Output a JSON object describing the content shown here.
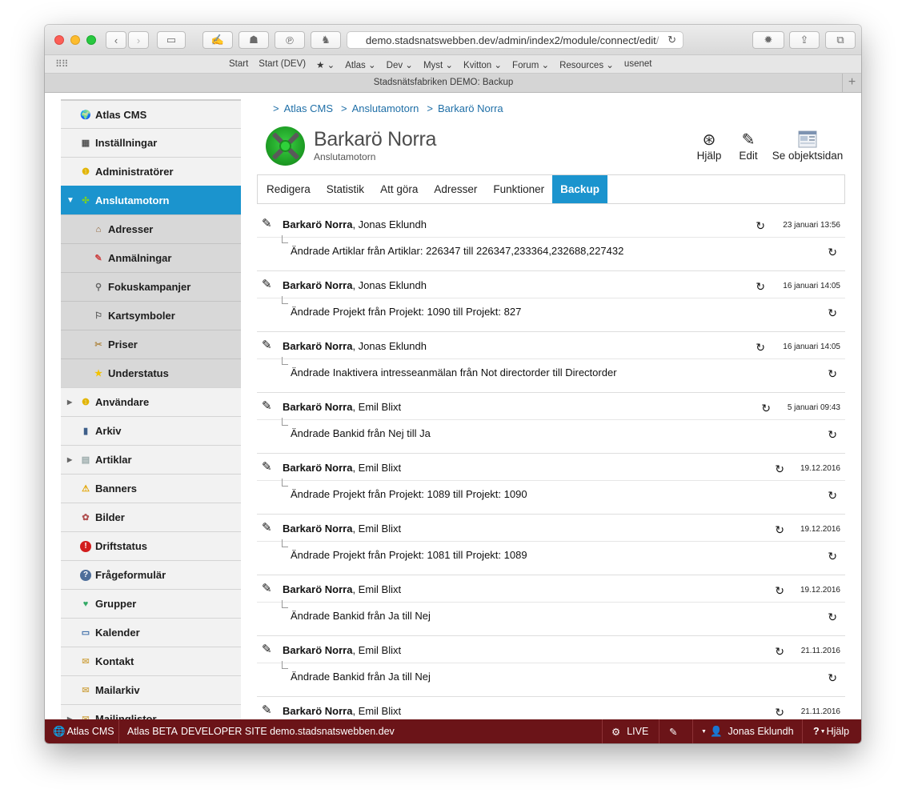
{
  "browser": {
    "url_main": "demo.stadsnatswebben.dev/admin/index2/module/connect/edit",
    "url_dim": "/",
    "tab_title": "Stadsnätsfabriken DEMO: Backup",
    "bookmarks": [
      "Start",
      "Start (DEV)",
      "★ ⌄",
      "Atlas ⌄",
      "Dev ⌄",
      "Myst ⌄",
      "Kvitton ⌄",
      "Forum ⌄",
      "Resources ⌄",
      "usenet"
    ]
  },
  "sidebar": {
    "items": [
      {
        "label": "Atlas CMS",
        "icon": "globe-icon",
        "glyph": "🌍",
        "type": "top"
      },
      {
        "label": "Inställningar",
        "icon": "settings-panel-icon",
        "glyph": "▦",
        "type": "top"
      },
      {
        "label": "Administratörer",
        "icon": "admin-user-icon",
        "glyph": "❶",
        "type": "top"
      },
      {
        "label": "Anslutamotorn",
        "icon": "connect-engine-icon",
        "glyph": "✣",
        "type": "active",
        "arrow": "▼"
      },
      {
        "label": "Adresser",
        "icon": "house-icon",
        "glyph": "⌂",
        "type": "sub"
      },
      {
        "label": "Anmälningar",
        "icon": "form-icon",
        "glyph": "✎",
        "type": "sub"
      },
      {
        "label": "Fokuskampanjer",
        "icon": "magnifier-icon",
        "glyph": "⚲",
        "type": "sub"
      },
      {
        "label": "Kartsymboler",
        "icon": "map-pin-icon",
        "glyph": "⚐",
        "type": "sub"
      },
      {
        "label": "Priser",
        "icon": "price-tag-icon",
        "glyph": "✂",
        "type": "sub"
      },
      {
        "label": "Understatus",
        "icon": "star-icon",
        "glyph": "★",
        "type": "sub"
      },
      {
        "label": "Användare",
        "icon": "users-icon",
        "glyph": "❶",
        "type": "top",
        "arrow": "▶"
      },
      {
        "label": "Arkiv",
        "icon": "archive-icon",
        "glyph": "▮",
        "type": "top"
      },
      {
        "label": "Artiklar",
        "icon": "articles-icon",
        "glyph": "▤",
        "type": "top",
        "arrow": "▶"
      },
      {
        "label": "Banners",
        "icon": "warning-icon",
        "glyph": "⚠",
        "type": "top"
      },
      {
        "label": "Bilder",
        "icon": "images-icon",
        "glyph": "✿",
        "type": "top"
      },
      {
        "label": "Driftstatus",
        "icon": "alert-icon",
        "glyph": "!",
        "type": "top"
      },
      {
        "label": "Frågeformulär",
        "icon": "question-icon",
        "glyph": "?",
        "type": "top"
      },
      {
        "label": "Grupper",
        "icon": "groups-icon",
        "glyph": "♥",
        "type": "top"
      },
      {
        "label": "Kalender",
        "icon": "calendar-icon",
        "glyph": "▭",
        "type": "top"
      },
      {
        "label": "Kontakt",
        "icon": "envelope-icon",
        "glyph": "✉",
        "type": "top"
      },
      {
        "label": "Mailarkiv",
        "icon": "mail-archive-icon",
        "glyph": "✉",
        "type": "top"
      },
      {
        "label": "Mailinglistor",
        "icon": "mailing-list-icon",
        "glyph": "✉",
        "type": "top",
        "arrow": "▶"
      }
    ]
  },
  "breadcrumbs": [
    {
      "sep": ">",
      "label": "Atlas CMS"
    },
    {
      "sep": ">",
      "label": "Anslutamotorn"
    },
    {
      "sep": ">",
      "label": "Barkarö Norra"
    }
  ],
  "page": {
    "title": "Barkarö Norra",
    "subtitle": "Anslutamotorn",
    "actions": {
      "help": "Hjälp",
      "edit": "Edit",
      "view": "Se objektsidan"
    }
  },
  "tabs": [
    "Redigera",
    "Statistik",
    "Att göra",
    "Adresser",
    "Funktioner",
    "Backup"
  ],
  "active_tab": "Backup",
  "entries": [
    {
      "object": "Barkarö Norra",
      "user": ", Jonas Eklundh",
      "date": "23 januari 13:56",
      "message": "Ändrade Artiklar från Artiklar: 226347 till 226347,233364,232688,227432"
    },
    {
      "object": "Barkarö Norra",
      "user": ", Jonas Eklundh",
      "date": "16 januari 14:05",
      "message": "Ändrade Projekt från Projekt: 1090 till Projekt: 827"
    },
    {
      "object": "Barkarö Norra",
      "user": ", Jonas Eklundh",
      "date": "16 januari 14:05",
      "message": "Ändrade Inaktivera intresseanmälan från Not directorder till Directorder"
    },
    {
      "object": "Barkarö Norra",
      "user": ", Emil Blixt",
      "date": "5 januari 09:43",
      "message": "Ändrade Bankid från Nej till Ja"
    },
    {
      "object": "Barkarö Norra",
      "user": ", Emil Blixt",
      "date": "19.12.2016",
      "message": "Ändrade Projekt från Projekt: 1089 till Projekt: 1090"
    },
    {
      "object": "Barkarö Norra",
      "user": ", Emil Blixt",
      "date": "19.12.2016",
      "message": "Ändrade Projekt från Projekt: 1081 till Projekt: 1089"
    },
    {
      "object": "Barkarö Norra",
      "user": ", Emil Blixt",
      "date": "19.12.2016",
      "message": "Ändrade Bankid från Ja till Nej"
    },
    {
      "object": "Barkarö Norra",
      "user": ", Emil Blixt",
      "date": "21.11.2016",
      "message": "Ändrade Bankid från Ja till Nej"
    },
    {
      "object": "Barkarö Norra",
      "user": ", Emil Blixt",
      "date": "21.11.2016",
      "message": ""
    }
  ],
  "bottombar": {
    "brand": "Atlas CMS",
    "beta": "Atlas BETA",
    "developer": "DEVELOPER SITE demo.stadsnatswebben.dev",
    "live": "LIVE",
    "user": "Jonas Eklundh",
    "help": "Hjälp"
  },
  "colors": {
    "accent": "#1b94ce",
    "bottombar": "#6b1418",
    "link": "#1f6fa7"
  }
}
